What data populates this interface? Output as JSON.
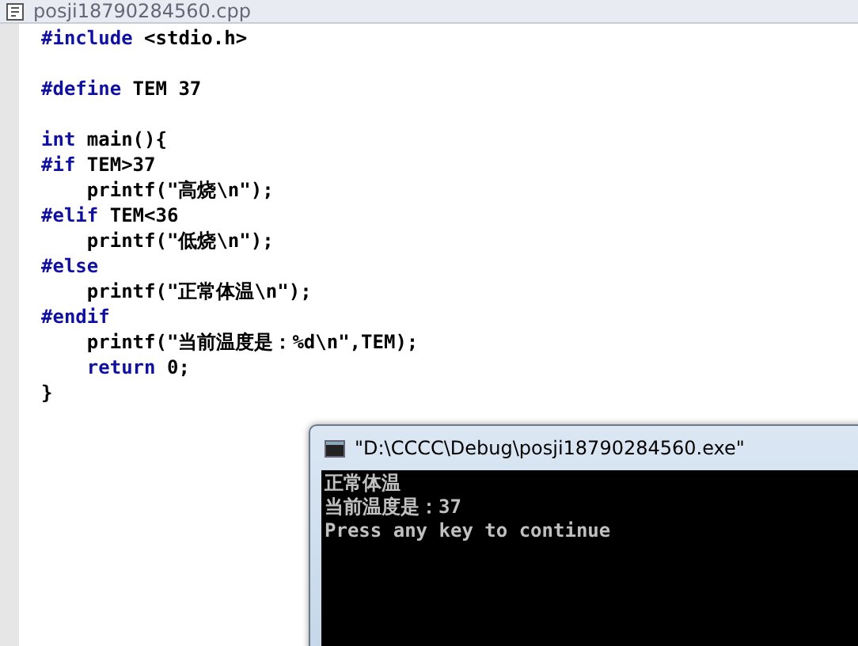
{
  "editor": {
    "tab_title": "posji18790284560.cpp",
    "blocks": [
      [
        {
          "indented": false,
          "segments": [
            {
              "kind": "keyword",
              "text": "#include"
            },
            {
              "kind": "plain",
              "text": " <stdio.h>"
            }
          ]
        }
      ],
      [
        {
          "indented": false,
          "segments": [
            {
              "kind": "keyword",
              "text": "#define"
            },
            {
              "kind": "plain",
              "text": " TEM 37"
            }
          ]
        }
      ],
      [
        {
          "indented": false,
          "segments": [
            {
              "kind": "keyword",
              "text": "int"
            },
            {
              "kind": "plain",
              "text": " main(){"
            }
          ]
        },
        {
          "indented": false,
          "segments": [
            {
              "kind": "keyword",
              "text": "#if"
            },
            {
              "kind": "plain",
              "text": " TEM>37"
            }
          ]
        },
        {
          "indented": true,
          "segments": [
            {
              "kind": "plain",
              "text": "printf(\"高烧\\n\");"
            }
          ]
        },
        {
          "indented": false,
          "segments": [
            {
              "kind": "keyword",
              "text": "#elif"
            },
            {
              "kind": "plain",
              "text": " TEM<36"
            }
          ]
        },
        {
          "indented": true,
          "segments": [
            {
              "kind": "plain",
              "text": "printf(\"低烧\\n\");"
            }
          ]
        },
        {
          "indented": false,
          "segments": [
            {
              "kind": "keyword",
              "text": "#else"
            }
          ]
        },
        {
          "indented": true,
          "segments": [
            {
              "kind": "plain",
              "text": "printf(\"正常体温\\n\");"
            }
          ]
        },
        {
          "indented": false,
          "segments": [
            {
              "kind": "keyword",
              "text": "#endif"
            }
          ]
        },
        {
          "indented": true,
          "segments": [
            {
              "kind": "plain",
              "text": "printf(\"当前温度是：%d\\n\",TEM);"
            }
          ]
        },
        {
          "indented": true,
          "segments": [
            {
              "kind": "keyword",
              "text": "return"
            },
            {
              "kind": "plain",
              "text": " 0;"
            }
          ]
        },
        {
          "indented": false,
          "segments": [
            {
              "kind": "plain",
              "text": "}"
            }
          ]
        }
      ]
    ]
  },
  "console": {
    "title": "\"D:\\CCCC\\Debug\\posji18790284560.exe\"",
    "lines": [
      "正常体温",
      "当前温度是：37",
      "Press any key to continue"
    ]
  }
}
